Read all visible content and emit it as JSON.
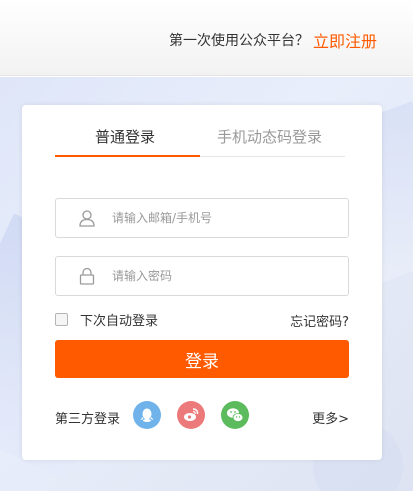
{
  "header": {
    "question": "第一次使用公众平台？",
    "register_link": "立即注册"
  },
  "login": {
    "tabs": [
      {
        "label": "普通登录",
        "active": true
      },
      {
        "label": "手机动态码登录",
        "active": false
      }
    ],
    "username_placeholder": "请输入邮箱/手机号",
    "password_placeholder": "请输入密码",
    "remember_label": "下次自动登录",
    "remember_checked": false,
    "forgot_label": "忘记密码?",
    "submit_label": "登录",
    "third_party_label": "第三方登录",
    "social": [
      {
        "name": "qq-icon",
        "color": "#6fb3ea"
      },
      {
        "name": "weibo-icon",
        "color": "#ec7a7a"
      },
      {
        "name": "wechat-icon",
        "color": "#5cbb5c"
      }
    ],
    "more_label": "更多>"
  },
  "colors": {
    "accent": "#ff5a00"
  }
}
